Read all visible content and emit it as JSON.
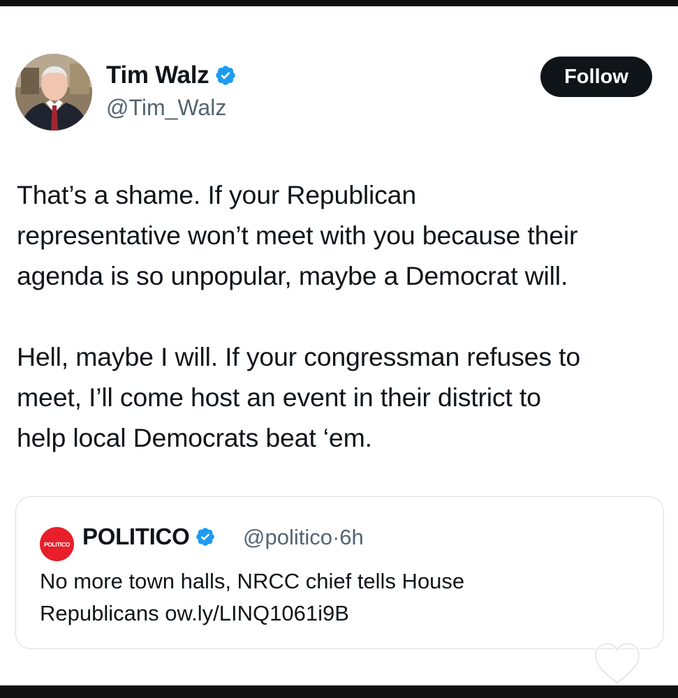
{
  "author": {
    "name": "Tim Walz",
    "handle": "@Tim_Walz",
    "verified": true
  },
  "follow_button": {
    "label": "Follow"
  },
  "tweet": {
    "paragraphs": [
      [
        "That’s a shame. If your Republican",
        "representative won’t meet with you because their",
        "agenda is so unpopular, maybe a Democrat will."
      ],
      [
        "Hell, maybe I will. If your congressman refuses to",
        "meet, I’ll come host an event in their district to",
        "help local Democrats beat ‘em."
      ]
    ]
  },
  "quote": {
    "avatar_text": "POLITICO",
    "name": "POLITICO",
    "verified": true,
    "handle": "@politico",
    "separator": "·",
    "time": "6h",
    "text_lines": [
      "No more town halls, NRCC chief tells House",
      "Republicans ow.ly/LINQ1061i9B"
    ]
  },
  "colors": {
    "text": "#0f1419",
    "secondary": "#536471",
    "verified": "#1d9bf0",
    "politico_red": "#e81f2a",
    "card_border": "#d9dfe3"
  },
  "icons": {
    "verified": "verified-badge-icon",
    "heart": "heart-outline-icon"
  }
}
